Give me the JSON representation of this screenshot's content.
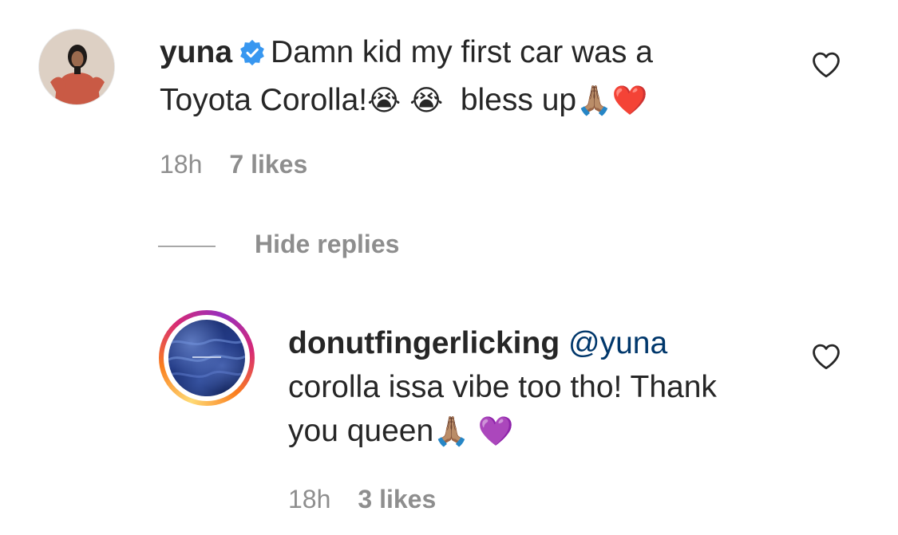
{
  "comment": {
    "username": "yuna",
    "text_line1": "Damn kid my first car was a",
    "text_line2": "Toyota Corolla!",
    "emoji_cry": "😭",
    "text_bless": "bless up",
    "emoji_pray": "🙏🏽",
    "emoji_heart": "❤️",
    "time": "18h",
    "likes": "7 likes"
  },
  "replies_toggle": "Hide replies",
  "reply": {
    "username": "donutfingerlicking",
    "mention": "@yuna",
    "text_line1": "corolla issa vibe too tho! Thank",
    "text_line2": "you queen",
    "emoji_pray": "🙏🏽",
    "emoji_heart": "💜",
    "time": "18h",
    "likes": "3 likes"
  },
  "icons": {
    "verified": "verified-badge-icon",
    "like": "heart-outline-icon"
  },
  "colors": {
    "text": "#262626",
    "secondary": "#8e8e8e",
    "mention": "#00376b",
    "verified": "#3897f0"
  }
}
